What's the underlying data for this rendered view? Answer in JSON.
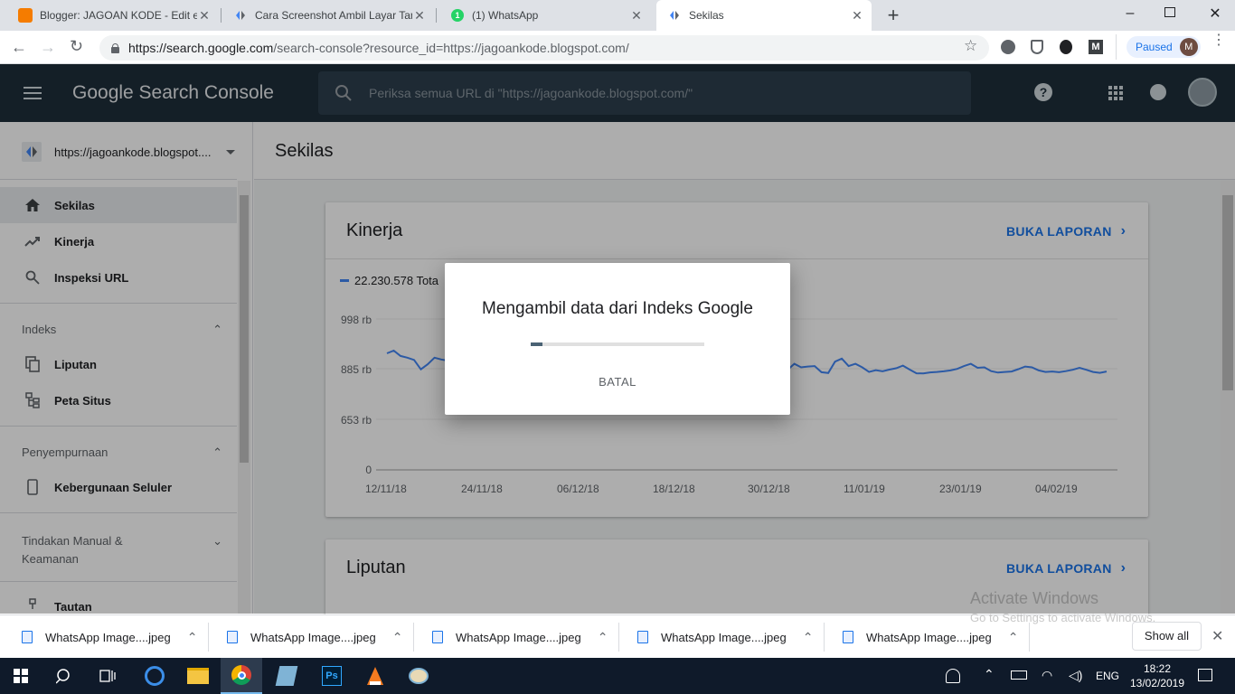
{
  "browser": {
    "tabs": [
      {
        "title": "Blogger: JAGOAN KODE - Edit en",
        "icon": "blogger-icon"
      },
      {
        "title": "Cara Screenshot Ambil Layar Tanj",
        "icon": "search-console-icon"
      },
      {
        "title": "(1) WhatsApp",
        "icon": "whatsapp-icon"
      },
      {
        "title": "Sekilas",
        "icon": "search-console-icon"
      }
    ],
    "url_host": "https://search.google.com",
    "url_path": "/search-console?resource_id=https://jagoankode.blogspot.com/",
    "paused_label": "Paused",
    "profile_initial": "M"
  },
  "gsc": {
    "product_name": "Google Search Console",
    "search_placeholder": "Periksa semua URL di \"https://jagoankode.blogspot.com/\"",
    "property": "https://jagoankode.blogspot....",
    "page_title": "Sekilas"
  },
  "nav": {
    "top_items": [
      {
        "label": "Sekilas",
        "icon": "home-icon"
      },
      {
        "label": "Kinerja",
        "icon": "trending-up-icon"
      },
      {
        "label": "Inspeksi URL",
        "icon": "search-icon"
      }
    ],
    "section_indeks": "Indeks",
    "indeks_items": [
      {
        "label": "Liputan",
        "icon": "copy-icon"
      },
      {
        "label": "Peta Situs",
        "icon": "sitemap-icon"
      }
    ],
    "section_penyempurnaan": "Penyempurnaan",
    "penyempurnaan_items": [
      {
        "label": "Kebergunaan Seluler",
        "icon": "phone-icon"
      }
    ],
    "section_tindakan_line1": "Tindakan Manual &",
    "section_tindakan_line2": "Keamanan",
    "tautan": "Tautan"
  },
  "cards": {
    "kinerja_title": "Kinerja",
    "liputan_title": "Liputan",
    "buka_laporan": "BUKA LAPORAN",
    "legend": "22.230.578 Tota"
  },
  "chart_data": {
    "type": "line",
    "title": "",
    "xlabel": "",
    "ylabel": "",
    "y_tick_labels": [
      "998 rb",
      "885 rb",
      "653 rb",
      "0"
    ],
    "x_tick_labels": [
      "12/11/18",
      "24/11/18",
      "06/12/18",
      "18/12/18",
      "30/12/18",
      "11/01/19",
      "23/01/19",
      "04/02/19"
    ],
    "series": [
      {
        "name": "22.230.578 Tota",
        "color": "#4285f4",
        "values": [
          920,
          926,
          914,
          910,
          905,
          882,
          895,
          910,
          906,
          903,
          899,
          896,
          893,
          890,
          891,
          888,
          887,
          890,
          885,
          889,
          884,
          892,
          898,
          893,
          900,
          896,
          899,
          902,
          897,
          906,
          903,
          900,
          885,
          905,
          902,
          889,
          888,
          880,
          895,
          887,
          890,
          892,
          881,
          902,
          913,
          901,
          897,
          883,
          882,
          875,
          892,
          896,
          907,
          924,
          880,
          876,
          888,
          858,
          881,
          880,
          896,
          888,
          890,
          891,
          869,
          865,
          901,
          908,
          891,
          896,
          888,
          870,
          878,
          873,
          881,
          886,
          892,
          881,
          864,
          863,
          868,
          870,
          873,
          877,
          884,
          891,
          896,
          887,
          888,
          874,
          867,
          870,
          872,
          883,
          890,
          888,
          877,
          870,
          872,
          869,
          874,
          880,
          887,
          880,
          870,
          866,
          872
        ]
      }
    ]
  },
  "dialog": {
    "title": "Mengambil data dari Indeks Google",
    "progress": 0.07,
    "cancel": "BATAL"
  },
  "downloads": {
    "items": [
      "WhatsApp Image....jpeg",
      "WhatsApp Image....jpeg",
      "WhatsApp Image....jpeg",
      "WhatsApp Image....jpeg",
      "WhatsApp Image....jpeg"
    ],
    "show_all": "Show all"
  },
  "watermark": {
    "line1": "Activate Windows",
    "line2": "Go to Settings to activate Windows."
  },
  "taskbar": {
    "lang": "ENG",
    "time": "18:22",
    "date": "13/02/2019"
  }
}
